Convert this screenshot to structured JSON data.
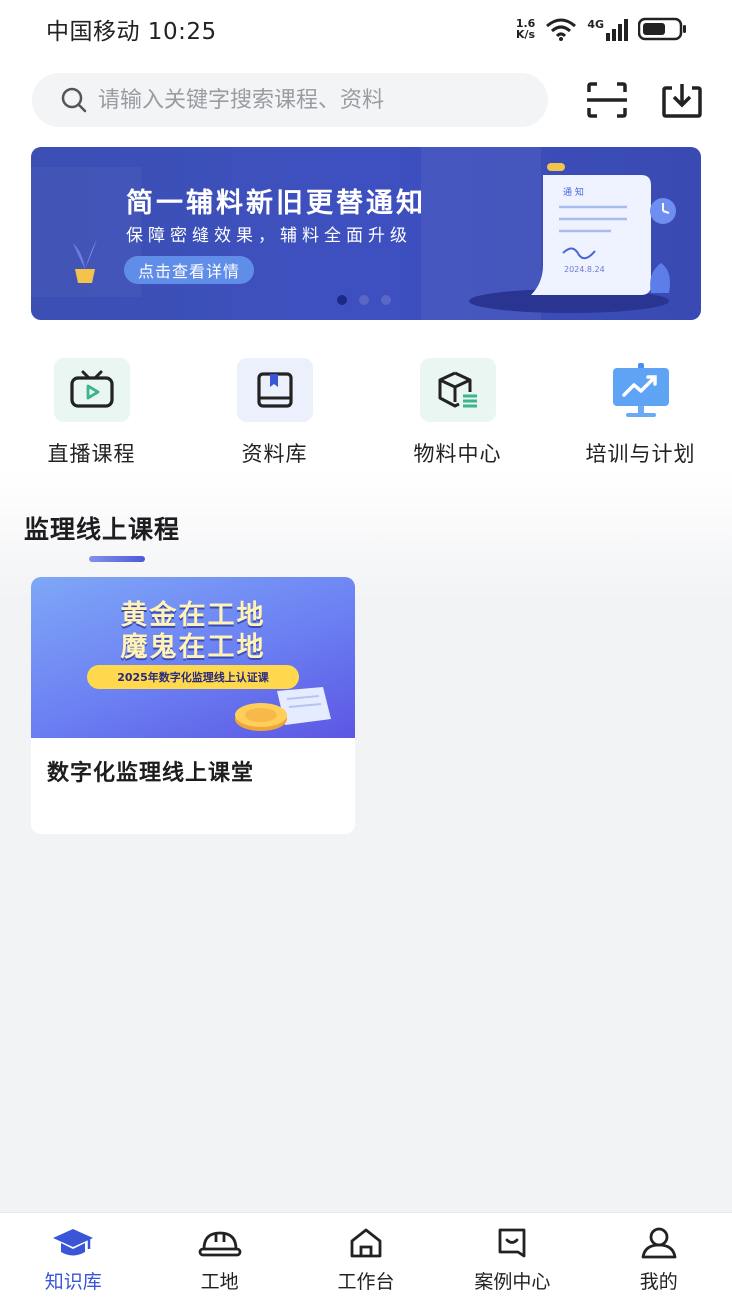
{
  "status_bar": {
    "carrier_time": "中国移动 10:25",
    "net_speed_value": "1.6",
    "net_speed_unit": "K/s",
    "network_type": "4G"
  },
  "search": {
    "placeholder": "请输入关键字搜索课程、资料"
  },
  "banner": {
    "title": "简一辅料新旧更替通知",
    "subtitle": "保障密缝效果，辅料全面升级",
    "button_label": "点击查看详情",
    "doc_heading": "通 知",
    "doc_date": "2024.8.24",
    "active_index": 0,
    "total_slides": 3
  },
  "quick_nav": [
    {
      "label": "直播课程",
      "icon": "tv-play-icon"
    },
    {
      "label": "资料库",
      "icon": "book-icon"
    },
    {
      "label": "物料中心",
      "icon": "cube-icon"
    },
    {
      "label": "培训与计划",
      "icon": "presentation-chart-icon"
    }
  ],
  "section": {
    "title": "监理线上课程"
  },
  "course": {
    "cover_line1": "黄金在工地",
    "cover_line2": "魔鬼在工地",
    "cover_badge": "2025年数字化监理线上认证课",
    "title": "数字化监理线上课堂"
  },
  "tab_bar": [
    {
      "label": "知识库",
      "icon": "graduation-cap-icon",
      "active": true
    },
    {
      "label": "工地",
      "icon": "hard-hat-icon",
      "active": false
    },
    {
      "label": "工作台",
      "icon": "home-icon",
      "active": false
    },
    {
      "label": "案例中心",
      "icon": "case-message-icon",
      "active": false
    },
    {
      "label": "我的",
      "icon": "user-icon",
      "active": false
    }
  ],
  "colors": {
    "accent": "#3a56d6",
    "banner_bg": "#3e50c0",
    "icon_green": "#3bb58a"
  }
}
